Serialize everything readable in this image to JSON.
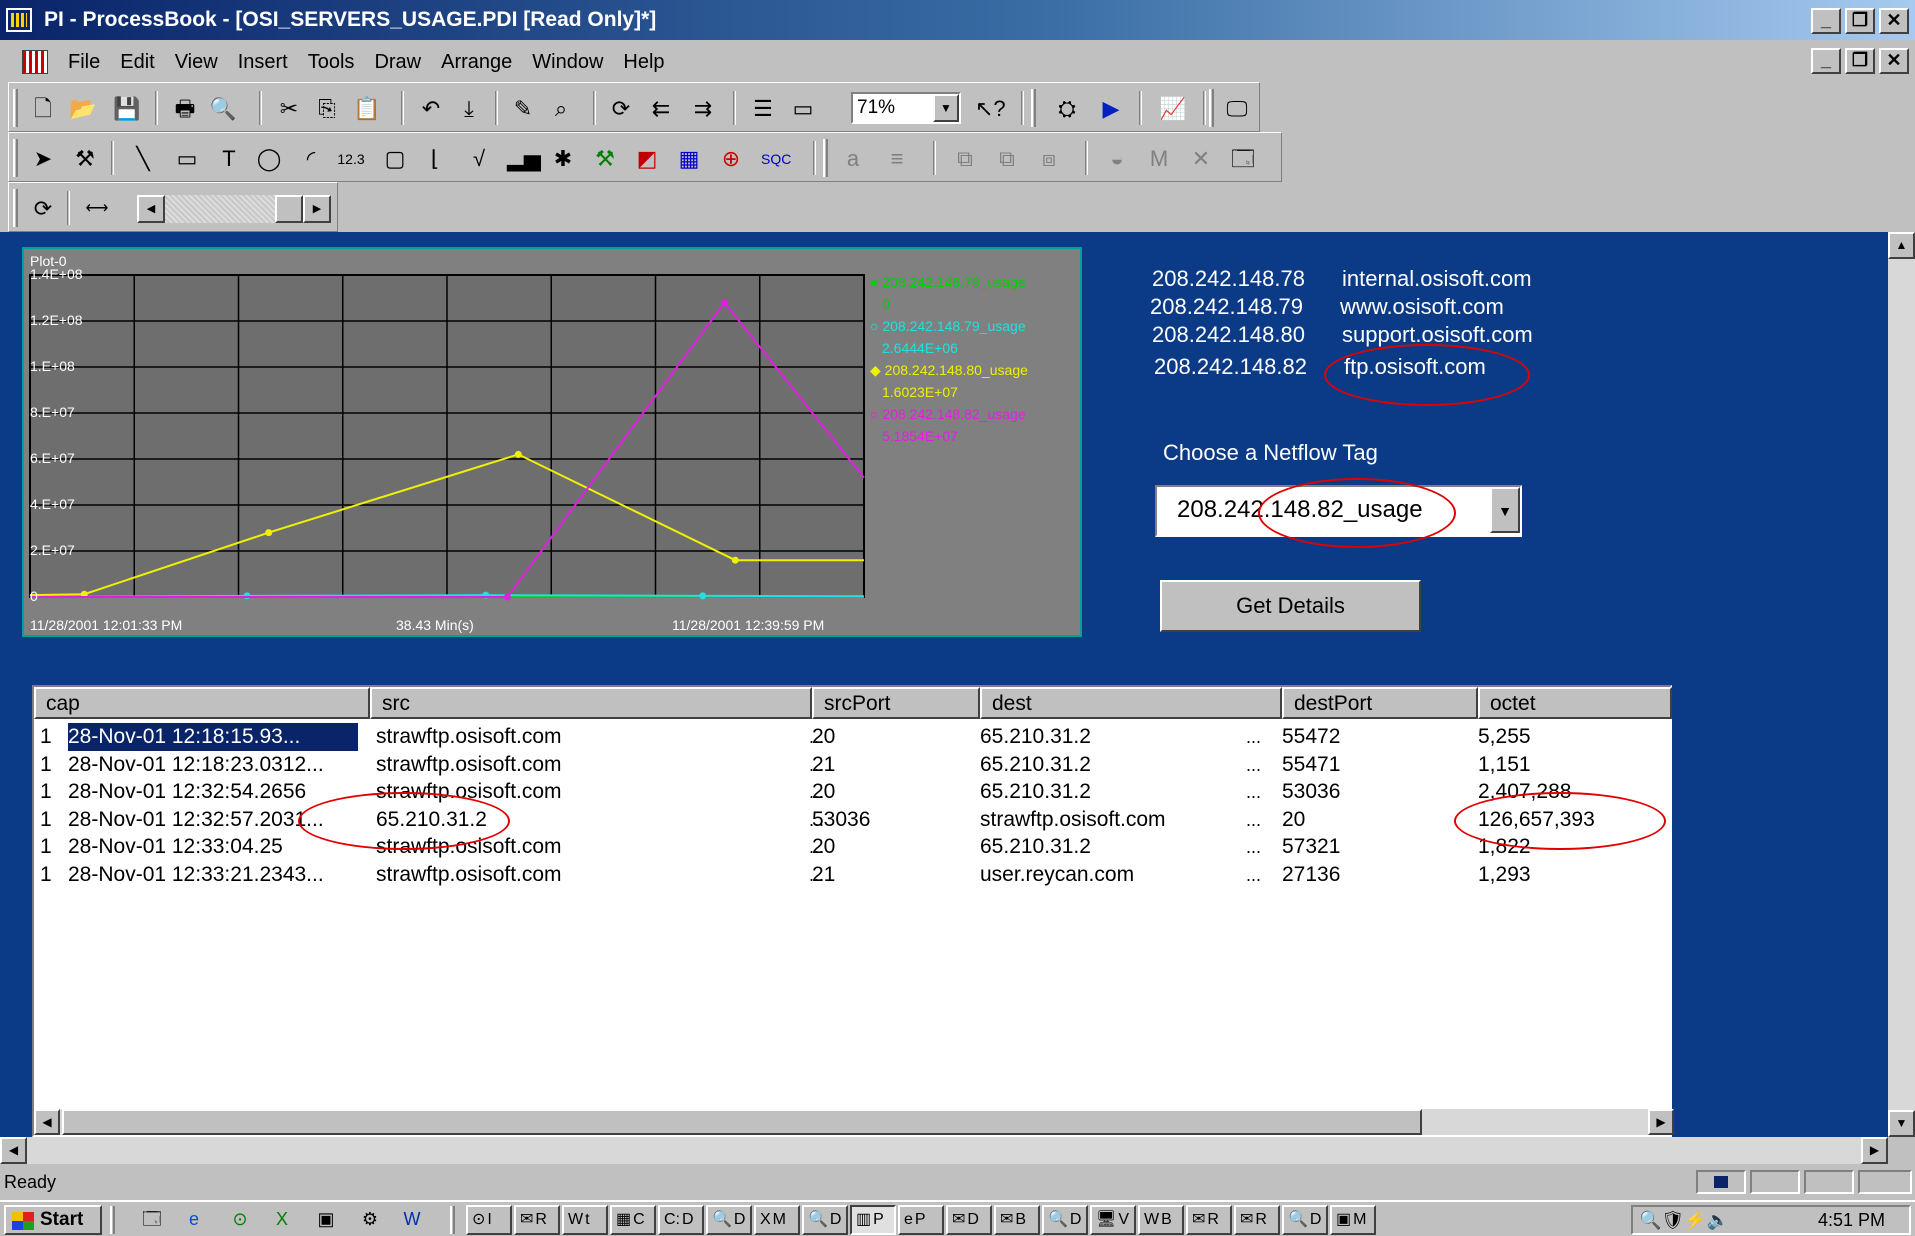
{
  "window": {
    "title": "PI - ProcessBook - [OSI_SERVERS_USAGE.PDI [Read Only]*]"
  },
  "menu": [
    "File",
    "Edit",
    "View",
    "Insert",
    "Tools",
    "Draw",
    "Arrange",
    "Window",
    "Help"
  ],
  "toolbar": {
    "zoom": "71%"
  },
  "plot": {
    "title": "Plot-0",
    "start": "11/28/2001 12:01:33 PM",
    "span": "38.43 Min(s)",
    "end": "11/28/2001 12:39:59 PM",
    "legend": [
      {
        "tag": "208.242.148.78_usage",
        "value": "0",
        "color": "#00d000"
      },
      {
        "tag": "208.242.148.79_usage",
        "value": "2.6444E+06",
        "color": "#20e0e0"
      },
      {
        "tag": "208.242.148.80_usage",
        "value": "1.6023E+07",
        "color": "#f0f000"
      },
      {
        "tag": "208.242.148.82_usage",
        "value": "5.1854E+07",
        "color": "#e020e0"
      }
    ]
  },
  "chart_data": {
    "type": "line",
    "title": "Plot-0",
    "xlabel": "38.43 Min(s)",
    "ylabel": "",
    "ylim": [
      0,
      140000000
    ],
    "xlim": [
      0,
      38.43
    ],
    "yticks": [
      "0",
      "2.E+07",
      "4.E+07",
      "6.E+07",
      "8.E+07",
      "1.E+08",
      "1.2E+08",
      "1.4E+08"
    ],
    "ytick_values": [
      0,
      20000000,
      40000000,
      60000000,
      80000000,
      100000000,
      120000000,
      140000000
    ],
    "x_axis_labels": [
      "11/28/2001 12:01:33 PM",
      "38.43 Min(s)",
      "11/28/2001 12:39:59 PM"
    ],
    "grid": true,
    "legend_position": "right",
    "series": [
      {
        "name": "208.242.148.78_usage",
        "color": "#00d000",
        "x": [
          0,
          38.43
        ],
        "y": [
          0,
          0
        ]
      },
      {
        "name": "208.242.148.79_usage",
        "color": "#20e0e0",
        "x": [
          0,
          10,
          21,
          31,
          38.43
        ],
        "y": [
          0,
          500000,
          800000,
          500000,
          300000
        ]
      },
      {
        "name": "208.242.148.80_usage",
        "color": "#f0f000",
        "x": [
          0,
          2.5,
          11,
          22.5,
          32.5,
          38.43
        ],
        "y": [
          800000,
          1200000,
          28000000,
          62000000,
          16000000,
          16000000
        ]
      },
      {
        "name": "208.242.148.82_usage",
        "color": "#e020e0",
        "x": [
          0,
          22,
          32,
          38.43
        ],
        "y": [
          0,
          0,
          128000000,
          51854000
        ]
      }
    ]
  },
  "ipinfo": [
    {
      "ip": "208.242.148.78",
      "host": "internal.osisoft.com"
    },
    {
      "ip": "208.242.148.79",
      "host": "www.osisoft.com"
    },
    {
      "ip": "208.242.148.80",
      "host": "support.osisoft.com"
    },
    {
      "ip": "208.242.148.82",
      "host": "ftp.osisoft.com"
    }
  ],
  "netflow": {
    "label": "Choose a Netflow Tag",
    "selected": "208.242.148.82_usage"
  },
  "buttons": {
    "get_details": "Get Details"
  },
  "table": {
    "columns": [
      "cap",
      "src",
      "srcPort",
      "dest",
      "destPort",
      "octet"
    ],
    "rows": [
      [
        "1",
        "28-Nov-01 12:18:15.93...",
        "strawftp.osisoft.com",
        "20",
        "65.210.31.2",
        "55472",
        "5,255"
      ],
      [
        "1",
        "28-Nov-01 12:18:23.0312...",
        "strawftp.osisoft.com",
        "21",
        "65.210.31.2",
        "55471",
        "1,151"
      ],
      [
        "1",
        "28-Nov-01 12:32:54.2656",
        "strawftp.osisoft.com",
        "20",
        "65.210.31.2",
        "53036",
        "2,407,288"
      ],
      [
        "1",
        "28-Nov-01 12:32:57.2031...",
        "65.210.31.2",
        "53036",
        "strawftp.osisoft.com",
        "20",
        "126,657,393"
      ],
      [
        "1",
        "28-Nov-01 12:33:04.25",
        "strawftp.osisoft.com",
        "20",
        "65.210.31.2",
        "57321",
        "1,822"
      ],
      [
        "1",
        "28-Nov-01 12:33:21.2343...",
        "strawftp.osisoft.com",
        "21",
        "user.reycan.com",
        "27136",
        "1,293"
      ]
    ],
    "ellipsis": "..."
  },
  "status": {
    "text": "Ready"
  },
  "taskbar": {
    "start": "Start",
    "buttons": [
      "I",
      "R",
      "t",
      "C",
      "D",
      "D",
      "M",
      "D",
      "P",
      "P",
      "D",
      "B",
      "D",
      "V",
      "B",
      "R",
      "R",
      "D",
      "M"
    ],
    "clock": "4:51 PM"
  },
  "colors": {
    "canvas": "#0b3a86",
    "annotation": "#e00000"
  }
}
